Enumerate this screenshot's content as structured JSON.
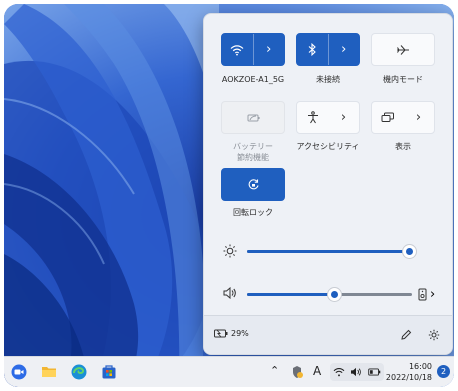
{
  "quick_settings": {
    "wifi": {
      "label": "AOKZOE-A1_5G",
      "active": true
    },
    "bluetooth": {
      "label": "未接続",
      "active": true
    },
    "airplane": {
      "label": "機内モード",
      "active": false
    },
    "battery_saver": {
      "label_line1": "バッテリー",
      "label_line2": "節約機能",
      "disabled": true
    },
    "accessibility": {
      "label": "アクセシビリティ"
    },
    "display": {
      "label": "表示"
    },
    "rotation_lock": {
      "label": "回転ロック",
      "active": true
    },
    "brightness_fraction": 0.98,
    "volume_fraction": 0.53,
    "battery_percent": "29%"
  },
  "taskbar": {
    "ime_indicator": "A",
    "time": "16:00",
    "date": "2022/10/18",
    "notification_count": "2"
  },
  "colors": {
    "accent": "#1f5fbf",
    "panel_bg": "#eef1f6",
    "taskbar_bg": "#eef0f4"
  },
  "icons": [
    "wifi-icon",
    "bluetooth-icon",
    "airplane-icon",
    "battery-saver-icon",
    "accessibility-icon",
    "display-icon",
    "rotation-lock-icon",
    "brightness-icon",
    "speaker-icon",
    "audio-output-icon",
    "battery-icon",
    "pencil-icon",
    "gear-icon"
  ]
}
